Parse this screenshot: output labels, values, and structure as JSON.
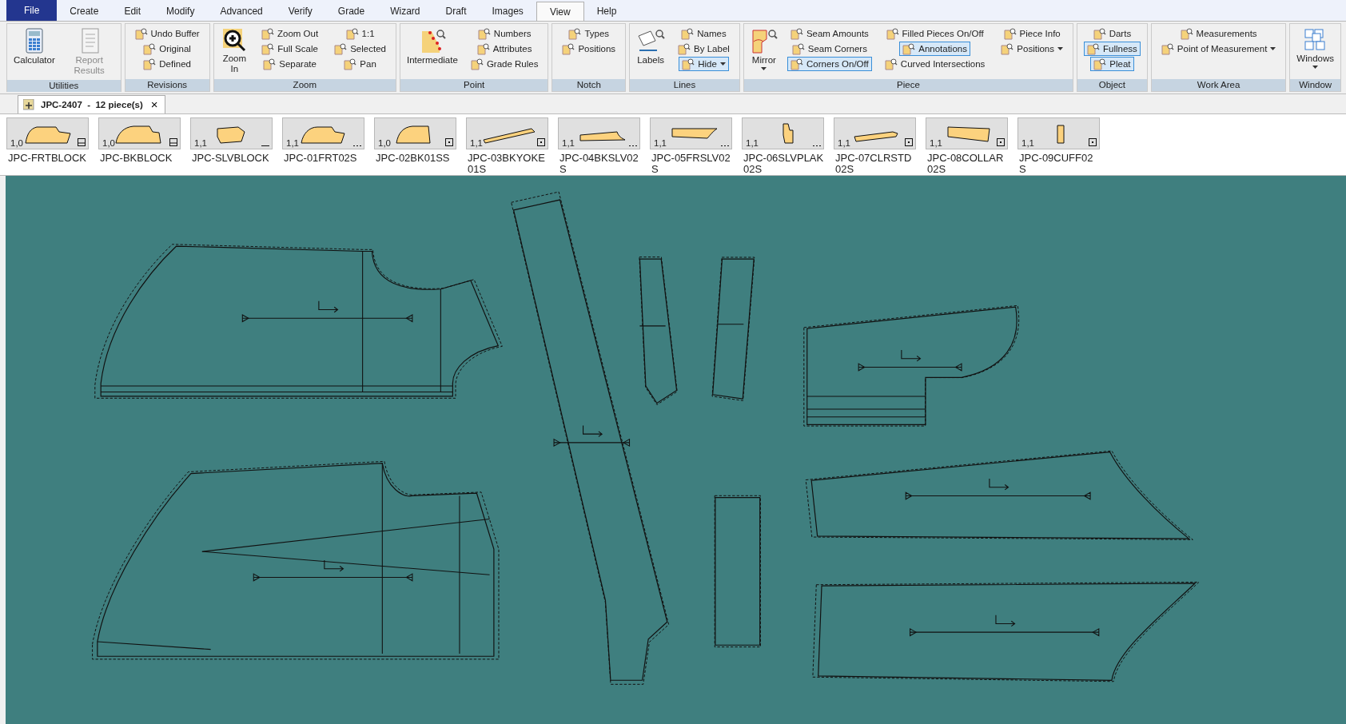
{
  "menu_tabs": [
    {
      "label": "File",
      "kind": "app",
      "selected": false
    },
    {
      "label": "Create",
      "kind": "tab",
      "selected": false
    },
    {
      "label": "Edit",
      "kind": "tab",
      "selected": false
    },
    {
      "label": "Modify",
      "kind": "tab",
      "selected": false
    },
    {
      "label": "Advanced",
      "kind": "tab",
      "selected": false
    },
    {
      "label": "Verify",
      "kind": "tab",
      "selected": false
    },
    {
      "label": "Grade",
      "kind": "tab",
      "selected": false
    },
    {
      "label": "Wizard",
      "kind": "tab",
      "selected": false
    },
    {
      "label": "Draft",
      "kind": "tab",
      "selected": false
    },
    {
      "label": "Images",
      "kind": "tab",
      "selected": false
    },
    {
      "label": "View",
      "kind": "tab",
      "selected": true
    },
    {
      "label": "Help",
      "kind": "tab",
      "selected": false
    }
  ],
  "ribbon_groups": [
    {
      "label": "Utilities",
      "columns": [
        {
          "kind": "large",
          "items": [
            {
              "label": "Calculator",
              "selected": false,
              "disabled": false,
              "dropdown": false
            }
          ]
        },
        {
          "kind": "large",
          "items": [
            {
              "label": "Report Results",
              "selected": false,
              "disabled": true,
              "dropdown": false
            }
          ]
        }
      ]
    },
    {
      "label": "Revisions",
      "columns": [
        {
          "kind": "small",
          "items": [
            {
              "label": "Undo Buffer",
              "selected": false,
              "disabled": false,
              "dropdown": false
            },
            {
              "label": "Original",
              "selected": false,
              "disabled": false,
              "dropdown": false
            },
            {
              "label": "Defined",
              "selected": false,
              "disabled": false,
              "dropdown": false
            }
          ]
        }
      ]
    },
    {
      "label": "Zoom",
      "columns": [
        {
          "kind": "large",
          "items": [
            {
              "label": "Zoom In",
              "selected": false,
              "disabled": false,
              "dropdown": false
            }
          ]
        },
        {
          "kind": "small",
          "items": [
            {
              "label": "Zoom Out",
              "selected": false,
              "disabled": false,
              "dropdown": false
            },
            {
              "label": "Full Scale",
              "selected": false,
              "disabled": false,
              "dropdown": false
            },
            {
              "label": "Separate",
              "selected": false,
              "disabled": false,
              "dropdown": false
            }
          ]
        },
        {
          "kind": "small",
          "items": [
            {
              "label": "1:1",
              "selected": false,
              "disabled": false,
              "dropdown": false
            },
            {
              "label": "Selected",
              "selected": false,
              "disabled": false,
              "dropdown": false
            },
            {
              "label": "Pan",
              "selected": false,
              "disabled": false,
              "dropdown": false
            }
          ]
        }
      ]
    },
    {
      "label": "Point",
      "columns": [
        {
          "kind": "large",
          "items": [
            {
              "label": "Intermediate",
              "selected": false,
              "disabled": false,
              "dropdown": false
            }
          ]
        },
        {
          "kind": "small",
          "items": [
            {
              "label": "Numbers",
              "selected": false,
              "disabled": false,
              "dropdown": false
            },
            {
              "label": "Attributes",
              "selected": false,
              "disabled": false,
              "dropdown": false
            },
            {
              "label": "Grade Rules",
              "selected": false,
              "disabled": false,
              "dropdown": false
            }
          ]
        }
      ]
    },
    {
      "label": "Notch",
      "columns": [
        {
          "kind": "small",
          "items": [
            {
              "label": "Types",
              "selected": false,
              "disabled": false,
              "dropdown": false
            },
            {
              "label": "Positions",
              "selected": false,
              "disabled": false,
              "dropdown": false
            }
          ]
        }
      ]
    },
    {
      "label": "Lines",
      "columns": [
        {
          "kind": "large",
          "items": [
            {
              "label": "Labels",
              "selected": false,
              "disabled": false,
              "dropdown": false
            }
          ]
        },
        {
          "kind": "small",
          "items": [
            {
              "label": "Names",
              "selected": false,
              "disabled": false,
              "dropdown": false
            },
            {
              "label": "By Label",
              "selected": false,
              "disabled": false,
              "dropdown": false
            },
            {
              "label": "Hide",
              "selected": true,
              "disabled": false,
              "dropdown": true
            }
          ]
        }
      ]
    },
    {
      "label": "Piece",
      "columns": [
        {
          "kind": "large",
          "items": [
            {
              "label": "Mirror",
              "selected": false,
              "disabled": false,
              "dropdown": true
            }
          ]
        },
        {
          "kind": "small",
          "items": [
            {
              "label": "Seam Amounts",
              "selected": false,
              "disabled": false,
              "dropdown": false
            },
            {
              "label": "Seam Corners",
              "selected": false,
              "disabled": false,
              "dropdown": false
            },
            {
              "label": "Corners On/Off",
              "selected": true,
              "disabled": false,
              "dropdown": false
            }
          ]
        },
        {
          "kind": "small",
          "items": [
            {
              "label": "Filled Pieces On/Off",
              "selected": false,
              "disabled": false,
              "dropdown": false
            },
            {
              "label": "Annotations",
              "selected": true,
              "disabled": false,
              "dropdown": false
            },
            {
              "label": "Curved Intersections",
              "selected": false,
              "disabled": false,
              "dropdown": false
            }
          ]
        },
        {
          "kind": "small",
          "items": [
            {
              "label": "Piece Info",
              "selected": false,
              "disabled": false,
              "dropdown": false
            },
            {
              "label": "Positions",
              "selected": false,
              "disabled": false,
              "dropdown": true
            }
          ]
        }
      ]
    },
    {
      "label": "Object",
      "columns": [
        {
          "kind": "small",
          "items": [
            {
              "label": "Darts",
              "selected": false,
              "disabled": false,
              "dropdown": false
            },
            {
              "label": "Fullness",
              "selected": true,
              "disabled": false,
              "dropdown": false
            },
            {
              "label": "Pleat",
              "selected": true,
              "disabled": false,
              "dropdown": false
            }
          ]
        }
      ]
    },
    {
      "label": "Work Area",
      "columns": [
        {
          "kind": "small",
          "items": [
            {
              "label": "Measurements",
              "selected": false,
              "disabled": false,
              "dropdown": false
            },
            {
              "label": "Point of Measurement",
              "selected": false,
              "disabled": false,
              "dropdown": true
            }
          ]
        }
      ]
    },
    {
      "label": "Window",
      "columns": [
        {
          "kind": "large",
          "items": [
            {
              "label": "Windows",
              "selected": false,
              "disabled": false,
              "dropdown": true
            }
          ]
        }
      ]
    }
  ],
  "document_tab": {
    "title": "JPC-2407  -  12 piece(s)",
    "close": "×"
  },
  "pieces": [
    {
      "name": "JPC-FRTBLOCK",
      "scale": "1,0",
      "kind": "lined"
    },
    {
      "name": "JPC-BKBLOCK",
      "scale": "1,0",
      "kind": "lined"
    },
    {
      "name": "JPC-SLVBLOCK",
      "scale": "1,1",
      "kind": "line"
    },
    {
      "name": "JPC-01FRT02S",
      "scale": "1,1",
      "kind": "dots"
    },
    {
      "name": "JPC-02BK01SS",
      "scale": "1,0",
      "kind": "dotted"
    },
    {
      "name": "JPC-03BKYOKE01S",
      "scale": "1,1",
      "kind": "dotted"
    },
    {
      "name": "JPC-04BKSLV02S",
      "scale": "1,1",
      "kind": "dots"
    },
    {
      "name": "JPC-05FRSLV02S",
      "scale": "1,1",
      "kind": "dots"
    },
    {
      "name": "JPC-06SLVPLAK02S",
      "scale": "1,1",
      "kind": "dots"
    },
    {
      "name": "JPC-07CLRSTD02S",
      "scale": "1,1",
      "kind": "dotted"
    },
    {
      "name": "JPC-08COLLAR02S",
      "scale": "1,1",
      "kind": "dotted"
    },
    {
      "name": "JPC-09CUFF02S",
      "scale": "1,1",
      "kind": "dotted"
    }
  ]
}
